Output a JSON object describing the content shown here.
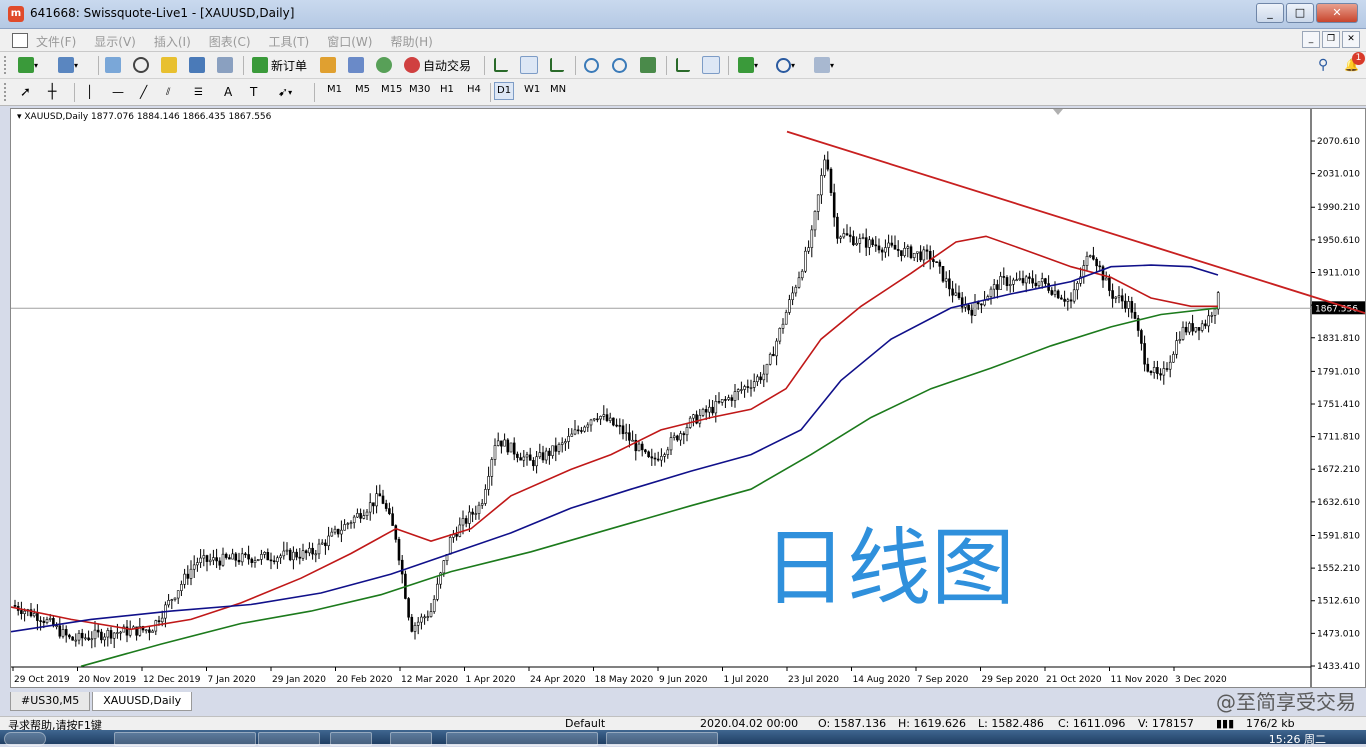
{
  "window": {
    "title": "641668: Swissquote-Live1 - [XAUUSD,Daily]"
  },
  "menu": [
    "文件(F)",
    "显示(V)",
    "插入(I)",
    "图表(C)",
    "工具(T)",
    "窗口(W)",
    "帮助(H)"
  ],
  "toolbar": {
    "new_order": "新订单",
    "auto_trading": "自动交易",
    "notification_count": "1"
  },
  "timeframes": [
    "M1",
    "M5",
    "M15",
    "M30",
    "H1",
    "H4",
    "D1",
    "W1",
    "MN"
  ],
  "active_timeframe": "D1",
  "chart": {
    "header": "XAUUSD,Daily  1877.076 1884.146 1866.435 1867.556",
    "overlay_text": "日线图",
    "price_labels": [
      "2070.610",
      "2031.010",
      "1990.210",
      "1950.610",
      "1911.010",
      "1871.410",
      "1831.810",
      "1791.010",
      "1751.410",
      "1711.810",
      "1672.210",
      "1632.610",
      "1591.810",
      "1552.210",
      "1512.610",
      "1473.010",
      "1433.410"
    ],
    "current_price": "1867.556",
    "date_labels": [
      "29 Oct 2019",
      "20 Nov 2019",
      "12 Dec 2019",
      "7 Jan 2020",
      "29 Jan 2020",
      "20 Feb 2020",
      "12 Mar 2020",
      "1 Apr 2020",
      "24 Apr 2020",
      "18 May 2020",
      "9 Jun 2020",
      "1 Jul 2020",
      "23 Jul 2020",
      "14 Aug 2020",
      "7 Sep 2020",
      "29 Sep 2020",
      "21 Oct 2020",
      "11 Nov 2020",
      "3 Dec 2020"
    ],
    "colors": {
      "ma_fast": "#c01818",
      "ma_mid": "#10108a",
      "ma_slow": "#1c7a1c",
      "trendline": "#c82020",
      "overlay": "#2f90dc"
    }
  },
  "tabs": [
    "#US30,M5",
    "XAUUSD,Daily"
  ],
  "active_tab": "XAUUSD,Daily",
  "watermark": "@至简享受交易",
  "status": {
    "help": "寻求帮助,请按F1键",
    "profile": "Default",
    "datetime": "2020.04.02 00:00",
    "open": "O: 1587.136",
    "high": "H: 1619.626",
    "low": "L: 1582.486",
    "close": "C: 1611.096",
    "volume": "V: 178157",
    "traffic": "176/2 kb"
  },
  "clock": "15:26 周二"
}
